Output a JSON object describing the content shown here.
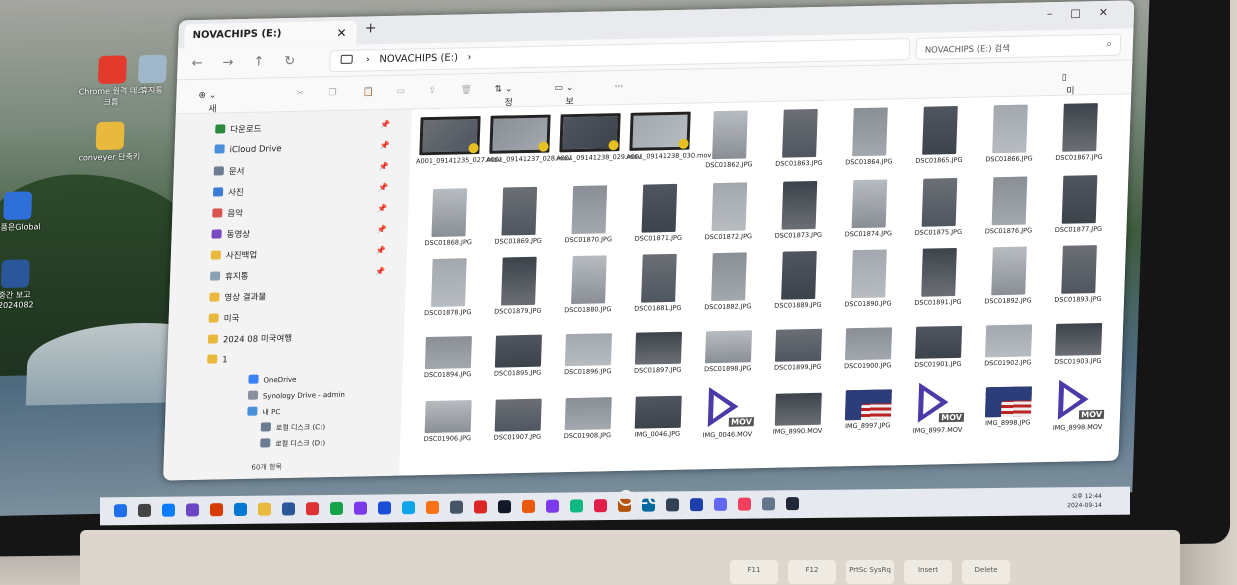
{
  "explorer": {
    "tab_title": "NOVACHIPS (E:)",
    "path": "NOVACHIPS (E:)",
    "search_placeholder": "NOVACHIPS (E:) 검색",
    "toolbar": {
      "new": "새로 만들기",
      "sort": "정렬",
      "view": "보기",
      "more": "···",
      "preview": "미리 보기"
    },
    "sidebar": [
      {
        "label": "다운로드",
        "color": "#2b8a3e",
        "pinned": true
      },
      {
        "label": "iCloud Drive",
        "color": "#4a90d9",
        "pinned": true
      },
      {
        "label": "문서",
        "color": "#6b7c93",
        "pinned": true
      },
      {
        "label": "사진",
        "color": "#3b7dd8",
        "pinned": true
      },
      {
        "label": "음악",
        "color": "#d9534f",
        "pinned": true
      },
      {
        "label": "동영상",
        "color": "#7b4bc4",
        "pinned": true
      },
      {
        "label": "사진백업",
        "color": "#e8b93c",
        "pinned": true
      },
      {
        "label": "휴지통",
        "color": "#8aa0b3",
        "pinned": true
      },
      {
        "label": "영상 결과물",
        "color": "#e8b93c",
        "pinned": false
      },
      {
        "label": "미국",
        "color": "#e8b93c",
        "pinned": false
      },
      {
        "label": "2024 08 미국여행",
        "color": "#e8b93c",
        "pinned": false
      },
      {
        "label": "1",
        "color": "#e8b93c",
        "pinned": false
      }
    ],
    "tree": [
      {
        "label": "OneDrive",
        "color": "#3b82f6"
      },
      {
        "label": "Synology Drive - admin",
        "color": "#8a8fa0"
      },
      {
        "label": "내 PC",
        "color": "#4a90d9"
      },
      {
        "label": "로컬 디스크 (C:)",
        "color": "#6b7c93"
      },
      {
        "label": "로컬 디스크 (D:)",
        "color": "#6b7c93"
      }
    ],
    "status": "60개 항목",
    "files": [
      {
        "name": "A001_09141235_027.mov",
        "kind": "video"
      },
      {
        "name": "A001_09141237_028.mov",
        "kind": "video"
      },
      {
        "name": "A001_09141238_029.mov",
        "kind": "video"
      },
      {
        "name": "A001_09141238_030.mov",
        "kind": "video"
      },
      {
        "name": "DSC01862.JPG",
        "kind": "photo"
      },
      {
        "name": "DSC01863.JPG",
        "kind": "photo"
      },
      {
        "name": "DSC01864.JPG",
        "kind": "photo"
      },
      {
        "name": "DSC01865.JPG",
        "kind": "photo"
      },
      {
        "name": "DSC01866.JPG",
        "kind": "photo"
      },
      {
        "name": "DSC01867.JPG",
        "kind": "photo"
      },
      {
        "name": "DSC01868.JPG",
        "kind": "photo"
      },
      {
        "name": "DSC01869.JPG",
        "kind": "photo"
      },
      {
        "name": "DSC01870.JPG",
        "kind": "photo"
      },
      {
        "name": "DSC01871.JPG",
        "kind": "photo"
      },
      {
        "name": "DSC01872.JPG",
        "kind": "photo"
      },
      {
        "name": "DSC01873.JPG",
        "kind": "photo"
      },
      {
        "name": "DSC01874.JPG",
        "kind": "photo"
      },
      {
        "name": "DSC01875.JPG",
        "kind": "photo"
      },
      {
        "name": "DSC01876.JPG",
        "kind": "photo"
      },
      {
        "name": "DSC01877.JPG",
        "kind": "photo"
      },
      {
        "name": "DSC01878.JPG",
        "kind": "photo"
      },
      {
        "name": "DSC01879.JPG",
        "kind": "photo"
      },
      {
        "name": "DSC01880.JPG",
        "kind": "photo"
      },
      {
        "name": "DSC01881.JPG",
        "kind": "photo"
      },
      {
        "name": "DSC01882.JPG",
        "kind": "photo"
      },
      {
        "name": "DSC01889.JPG",
        "kind": "photo"
      },
      {
        "name": "DSC01890.JPG",
        "kind": "photo"
      },
      {
        "name": "DSC01891.JPG",
        "kind": "photo"
      },
      {
        "name": "DSC01892.JPG",
        "kind": "photo"
      },
      {
        "name": "DSC01893.JPG",
        "kind": "photo"
      },
      {
        "name": "DSC01894.JPG",
        "kind": "photo"
      },
      {
        "name": "DSC01895.JPG",
        "kind": "photo"
      },
      {
        "name": "DSC01896.JPG",
        "kind": "photo"
      },
      {
        "name": "DSC01897.JPG",
        "kind": "photo"
      },
      {
        "name": "DSC01898.JPG",
        "kind": "photo"
      },
      {
        "name": "DSC01899.JPG",
        "kind": "photo"
      },
      {
        "name": "DSC01900.JPG",
        "kind": "photo"
      },
      {
        "name": "DSC01901.JPG",
        "kind": "photo"
      },
      {
        "name": "DSC01902.JPG",
        "kind": "photo"
      },
      {
        "name": "DSC01903.JPG",
        "kind": "photo"
      },
      {
        "name": "DSC01906.JPG",
        "kind": "photo"
      },
      {
        "name": "DSC01907.JPG",
        "kind": "photo"
      },
      {
        "name": "DSC01908.JPG",
        "kind": "photo"
      },
      {
        "name": "IMG_0046.JPG",
        "kind": "photo"
      },
      {
        "name": "IMG_0046.MOV",
        "kind": "mov"
      },
      {
        "name": "IMG_8990.MOV",
        "kind": "photo"
      },
      {
        "name": "IMG_8997.JPG",
        "kind": "flag"
      },
      {
        "name": "IMG_8997.MOV",
        "kind": "mov"
      },
      {
        "name": "IMG_8998.JPG",
        "kind": "flag"
      },
      {
        "name": "IMG_8998.MOV",
        "kind": "mov"
      }
    ]
  },
  "desktop": {
    "icons": [
      {
        "label": "Chrome 원격 데스크톱",
        "color": "#e23b2e"
      },
      {
        "label": "휴지통",
        "color": "#9fb7c9"
      },
      {
        "label": "conveyer 단축키",
        "color": "#e8b93c"
      },
      {
        "label": "명품은Global",
        "color": "#2f6fd8"
      },
      {
        "label": "중간 보고 (2024082",
        "color": "#2b579a"
      }
    ]
  },
  "badge": {
    "mov": "MOV"
  },
  "device": {
    "brand": "LG"
  },
  "keys": [
    "F11",
    "F12",
    "PrtSc SysRq",
    "Insert",
    "Delete"
  ],
  "taskbar": {
    "time": "오후 12:44",
    "date": "2024-09-14",
    "icon_colors": [
      "#1f6feb",
      "#444",
      "#0a7cff",
      "#6b47c6",
      "#d83b01",
      "#0078d4",
      "#e8b93c",
      "#2b579a",
      "#d33",
      "#16a34a",
      "#7c3aed",
      "#1d4ed8",
      "#0ea5e9",
      "#f97316",
      "#475569",
      "#dc2626",
      "#111827",
      "#ea580c",
      "#7c3aed",
      "#10b981",
      "#e11d48",
      "#b45309",
      "#0369a1",
      "#334155",
      "#1e40af",
      "#6366f1",
      "#f43f5e",
      "#64748b",
      "#1f2937"
    ]
  }
}
